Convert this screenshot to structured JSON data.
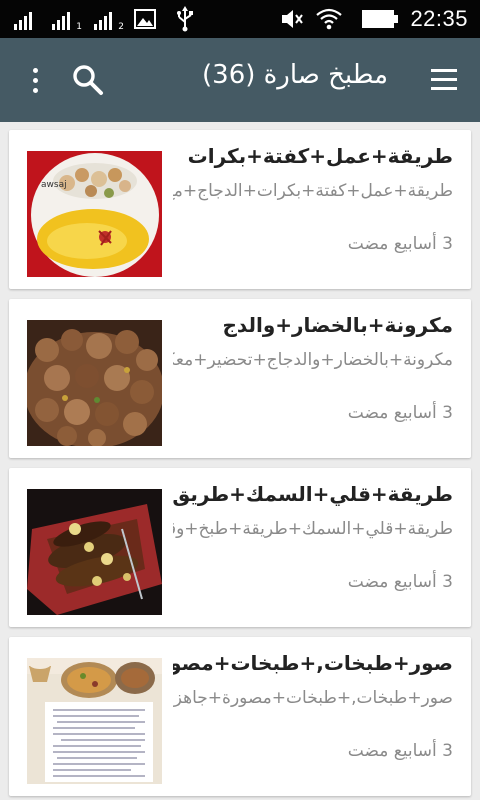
{
  "status_bar": {
    "time": "22:35",
    "icons": [
      "signal-icon",
      "signal-icon-1",
      "signal-icon-2",
      "image-icon",
      "usb-icon",
      "mute-icon",
      "wifi-icon",
      "battery-icon"
    ],
    "sim_labels": [
      "1",
      "2"
    ]
  },
  "app_bar": {
    "title": "مطبخ صارة (36)",
    "color": "#455a64",
    "icons": [
      "menu-icon",
      "search-icon",
      "more-vert-icon"
    ]
  },
  "recipes": [
    {
      "title": "طريقة+عمل+كفتة+بكرات",
      "description": "طريقة+عمل+كفتة+بكرات+الدجاج+مع+البطاطس+والطحينية",
      "time": "3 أسابيع مضت",
      "watermark": "awsaj"
    },
    {
      "title": "مكرونة+بالخضار+والدج",
      "description": "مكرونة+بالخضار+والدجاج+تحضير+معكرونة+مع+الدجاج+والخضار",
      "time": "3 أسابيع مضت"
    },
    {
      "title": "طريقة+قلي+السمك+طريق",
      "description": "طريقة+قلي+السمك+طريقة+طبخ+وقلي+السمك+بالدقه+والليمون",
      "time": "3 أسابيع مضت"
    },
    {
      "title": "صور+طبخات,+طبخات+مصو",
      "description": "صور+طبخات,+طبخات+مصورة+جاهزة+للحفظ,+طبخات+بالصور",
      "time": "3 أسابيع مضت"
    }
  ]
}
